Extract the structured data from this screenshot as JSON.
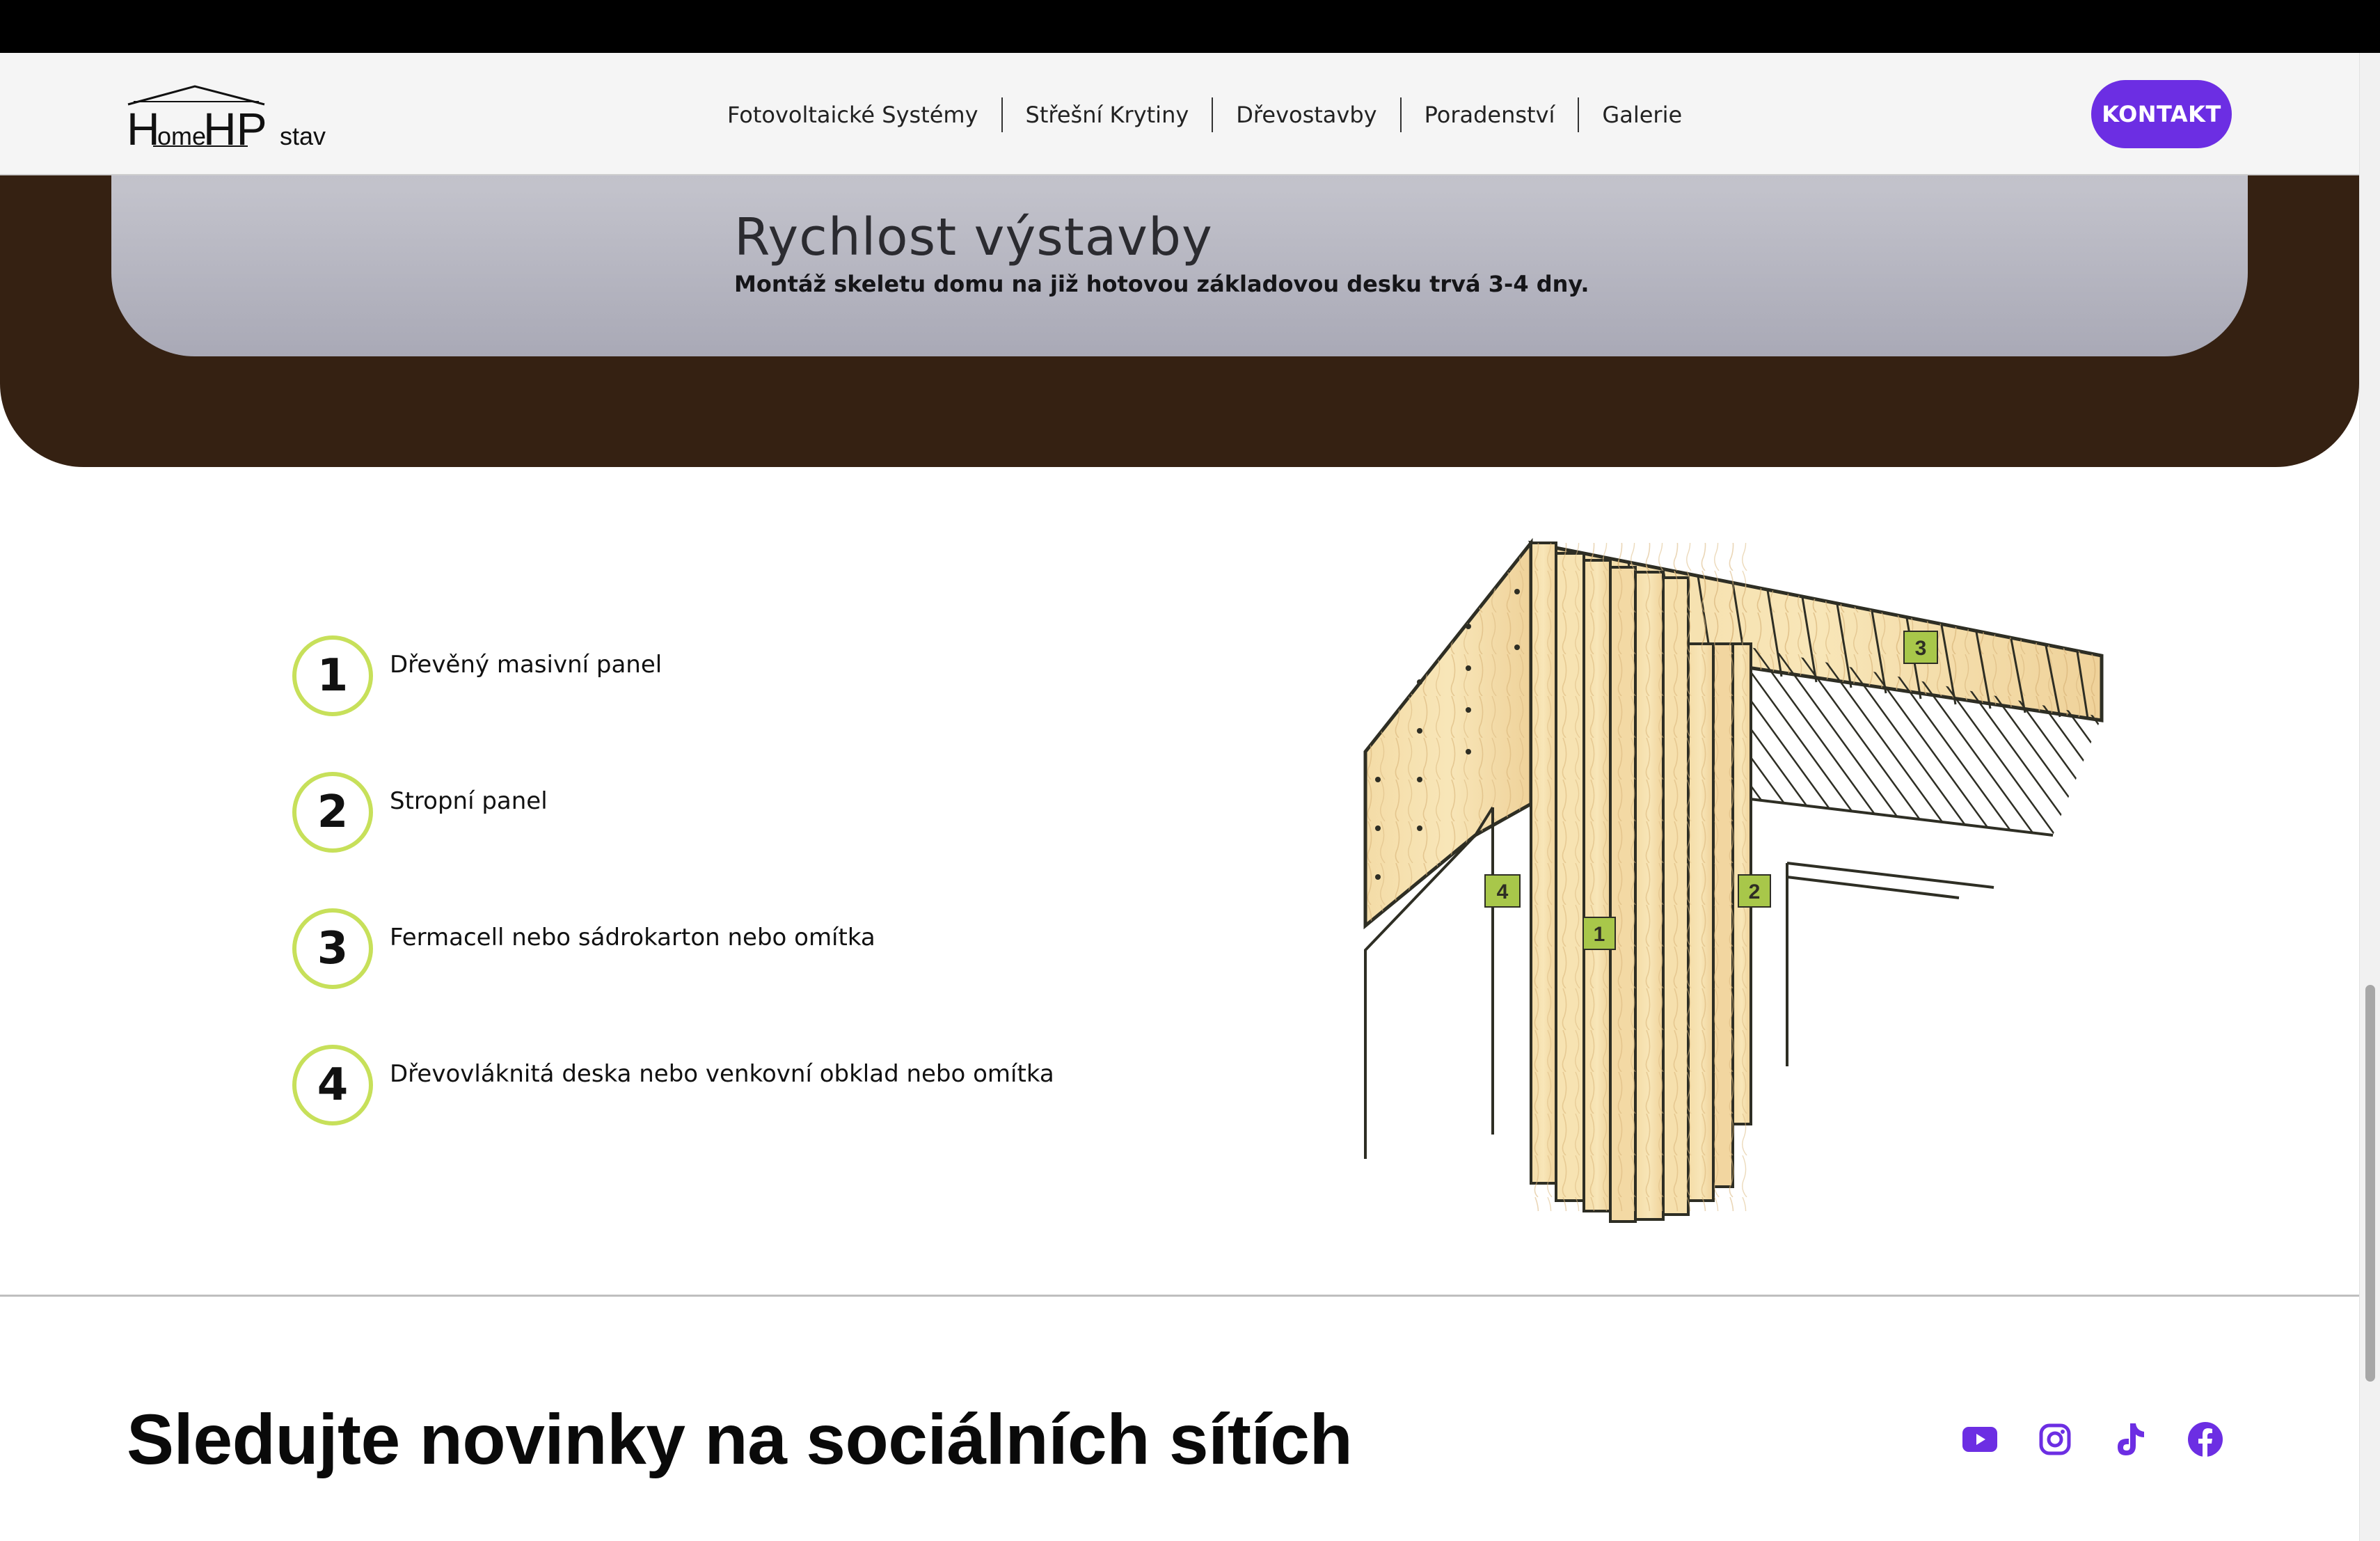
{
  "logo": {
    "brand": "HomeHPstav"
  },
  "nav": {
    "items": [
      "Fotovoltaické Systémy",
      "Střešní Krytiny",
      "Dřevostavby",
      "Poradenství",
      "Galerie"
    ],
    "cta": "KONTAKT"
  },
  "hero": {
    "title": "Rychlost výstavby",
    "subtitle": "Montáž skeletu domu na již hotovou základovou desku trvá 3-4 dny."
  },
  "layers": [
    {
      "number": "1",
      "label": "Dřevěný masivní panel"
    },
    {
      "number": "2",
      "label": "Stropní panel"
    },
    {
      "number": "3",
      "label": "Fermacell nebo sádrokarton nebo omítka"
    },
    {
      "number": "4",
      "label": "Dřevovláknitá deska nebo venkovní obklad nebo omítka"
    }
  ],
  "diagram": {
    "tags": [
      "1",
      "2",
      "3",
      "4"
    ]
  },
  "social": {
    "title": "Sledujte novinky na sociálních sítích",
    "icons": [
      "youtube-icon",
      "instagram-icon",
      "tiktok-icon",
      "facebook-icon"
    ],
    "color": "#6c2ee3"
  },
  "colors": {
    "accent": "#6c2ee3",
    "ring": "#c7e05a",
    "hero_band": "#352112"
  }
}
